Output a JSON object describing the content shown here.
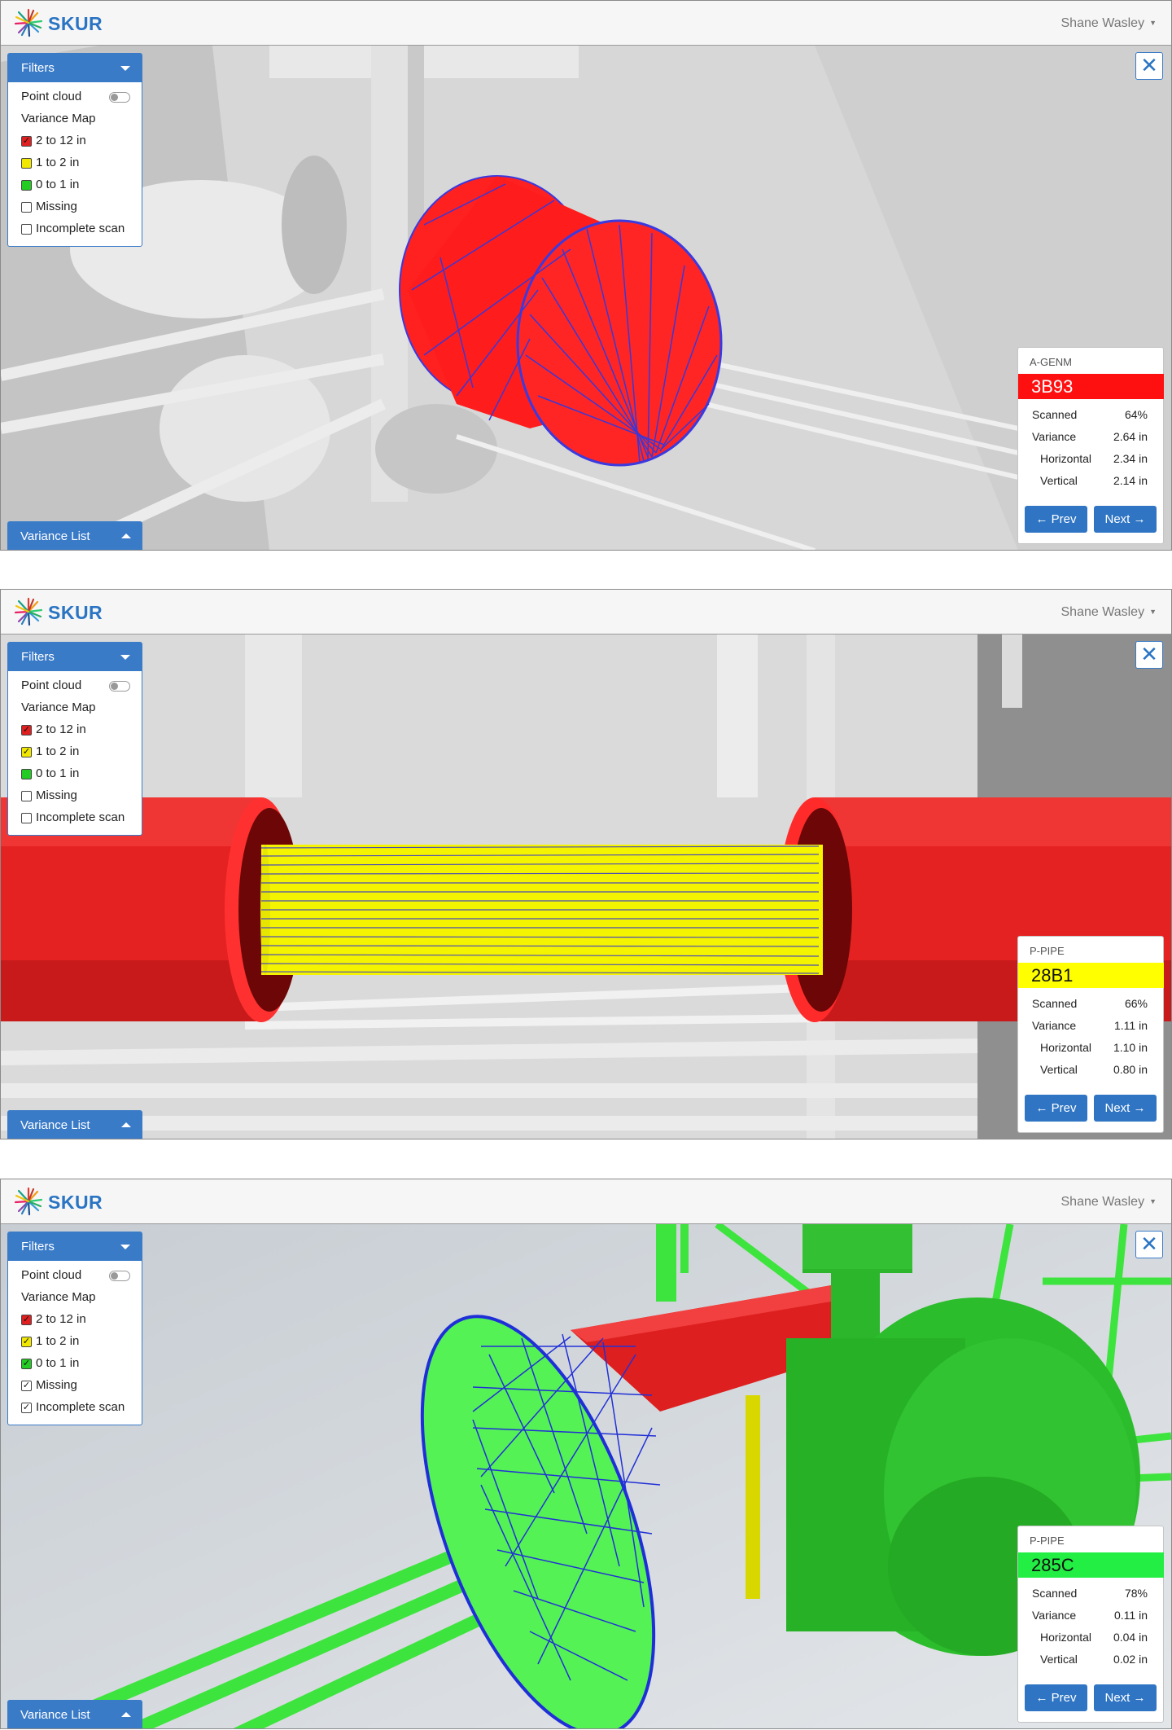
{
  "app": {
    "name": "SKUR",
    "user": "Shane Wasley"
  },
  "panels": [
    {
      "filters_title": "Filters",
      "point_cloud": "Point cloud",
      "variance_map": "Variance Map",
      "items": [
        {
          "label": "2 to 12 in",
          "color": "#e02020",
          "checked": true
        },
        {
          "label": "1 to 2 in",
          "color": "#f0e800",
          "checked": false
        },
        {
          "label": "0 to 1 in",
          "color": "#22cc22",
          "checked": false
        },
        {
          "label": "Missing",
          "color": "#ffffff",
          "checked": false
        },
        {
          "label": "Incomplete scan",
          "color": "#ffffff",
          "checked": false
        }
      ],
      "variance_list": "Variance List",
      "card": {
        "category": "A-GENM",
        "tag": "3B93",
        "tag_color": "#ff1010",
        "tag_text_color": "#ffffff",
        "rows": [
          {
            "label": "Scanned",
            "value": "64%"
          },
          {
            "label": "Variance",
            "value": "2.64 in"
          },
          {
            "label": "Horizontal",
            "value": "2.34 in"
          },
          {
            "label": "Vertical",
            "value": "2.14 in"
          }
        ],
        "prev": "← Prev",
        "next": "Next →"
      }
    },
    {
      "filters_title": "Filters",
      "point_cloud": "Point cloud",
      "variance_map": "Variance Map",
      "items": [
        {
          "label": "2 to 12 in",
          "color": "#e02020",
          "checked": true
        },
        {
          "label": "1 to 2 in",
          "color": "#f0e800",
          "checked": true
        },
        {
          "label": "0 to 1 in",
          "color": "#22cc22",
          "checked": false
        },
        {
          "label": "Missing",
          "color": "#ffffff",
          "checked": false
        },
        {
          "label": "Incomplete scan",
          "color": "#ffffff",
          "checked": false
        }
      ],
      "variance_list": "Variance List",
      "card": {
        "category": "P-PIPE",
        "tag": "28B1",
        "tag_color": "#ffff00",
        "tag_text_color": "#111111",
        "rows": [
          {
            "label": "Scanned",
            "value": "66%"
          },
          {
            "label": "Variance",
            "value": "1.11 in"
          },
          {
            "label": "Horizontal",
            "value": "1.10 in"
          },
          {
            "label": "Vertical",
            "value": "0.80 in"
          }
        ],
        "prev": "← Prev",
        "next": "Next →"
      }
    },
    {
      "filters_title": "Filters",
      "point_cloud": "Point cloud",
      "variance_map": "Variance Map",
      "items": [
        {
          "label": "2 to 12 in",
          "color": "#e02020",
          "checked": true
        },
        {
          "label": "1 to 2 in",
          "color": "#f0e800",
          "checked": true
        },
        {
          "label": "0 to 1 in",
          "color": "#22cc22",
          "checked": true
        },
        {
          "label": "Missing",
          "color": "#ffffff",
          "checked": true
        },
        {
          "label": "Incomplete scan",
          "color": "#ffffff",
          "checked": true
        }
      ],
      "variance_list": "Variance List",
      "card": {
        "category": "P-PIPE",
        "tag": "285C",
        "tag_color": "#22ee44",
        "tag_text_color": "#111111",
        "rows": [
          {
            "label": "Scanned",
            "value": "78%"
          },
          {
            "label": "Variance",
            "value": "0.11 in"
          },
          {
            "label": "Horizontal",
            "value": "0.04 in"
          },
          {
            "label": "Vertical",
            "value": "0.02 in"
          }
        ],
        "prev": "← Prev",
        "next": "Next →"
      }
    }
  ]
}
